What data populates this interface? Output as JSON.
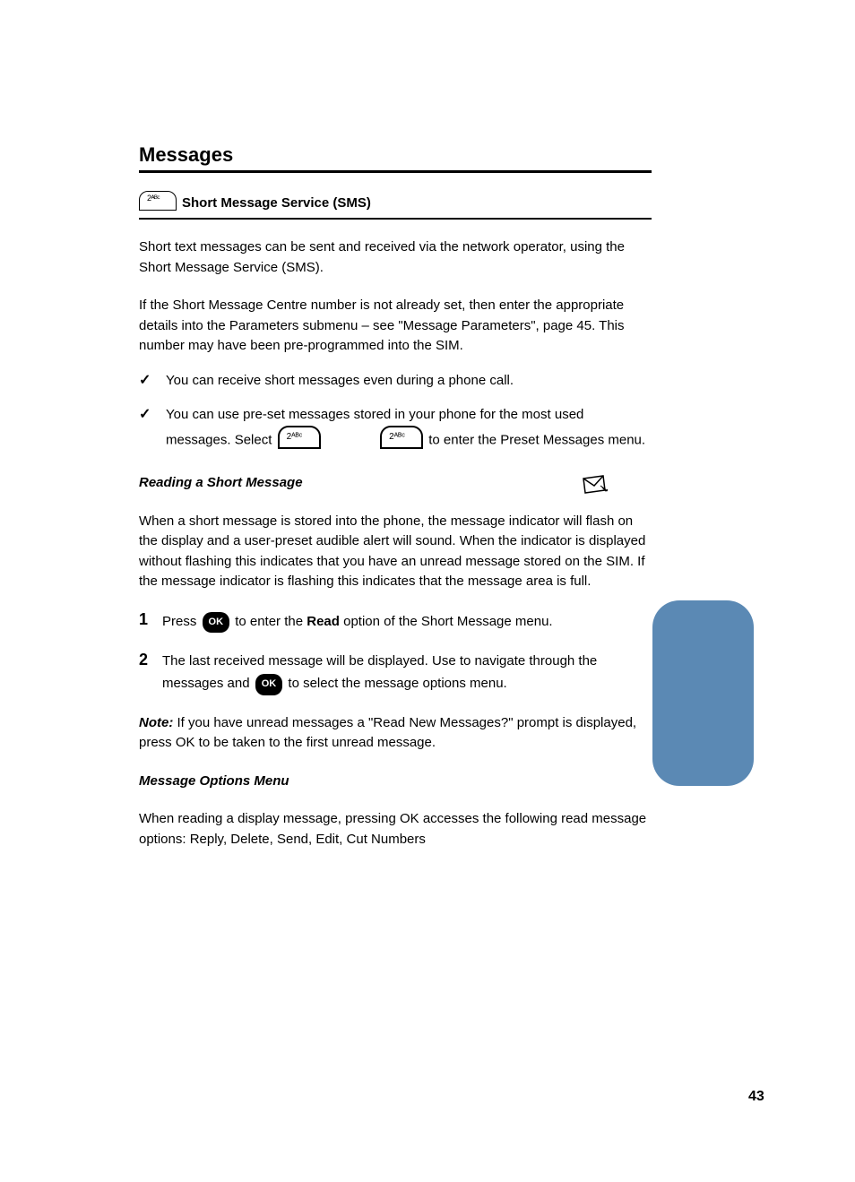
{
  "heading": "Messages",
  "subheading": "Short Message Service (SMS)",
  "body_intro_1": "Short text messages can be sent and received via the network operator, using the Short Message Service (SMS).",
  "body_intro_2": "If the Short Message Centre number is not already set, then enter the appropriate details into the Parameters submenu – see \"Message Parameters\", page 45. This number may have been pre-programmed into the SIM.",
  "check_1": "You can receive short messages even during a phone call.",
  "check_2_prefix": "You can use pre-set messages stored in your phone for the most used messages. Select",
  "check_2_mid": "to enter the Preset Messages menu.",
  "reading_heading": "Reading a Short Message",
  "reading_1_prefix": "When a short message is stored into the phone, the message indicator",
  "reading_1_suffix": " will flash on the display and a user-preset audible alert will sound. When the indicator is displayed without flashing this indicates that you have an unread message stored on the SIM. If the message indicator is flashing this indicates that the message area is full.",
  "step_1_prefix": "Press",
  "step_1_suffix": "to enter the ",
  "step_1_bold": "Read",
  "step_1_tail": " option of the Short Message menu.",
  "step_2_a": "The last received message will be displayed. Use ",
  "step_2_b": " to navigate through the messages and ",
  "step_2_c": " to select the message options menu.",
  "note_heading": "Note:",
  "note_body": " If you have unread messages a \"Read New Messages?\" prompt is displayed, press OK to be taken to the first unread message.",
  "menu_heading": "Message Options Menu",
  "menu_body": "When reading a display message, pressing OK accesses the following read message options: Reply, Delete, Send, Edit, Cut Numbers",
  "page_number": "43"
}
